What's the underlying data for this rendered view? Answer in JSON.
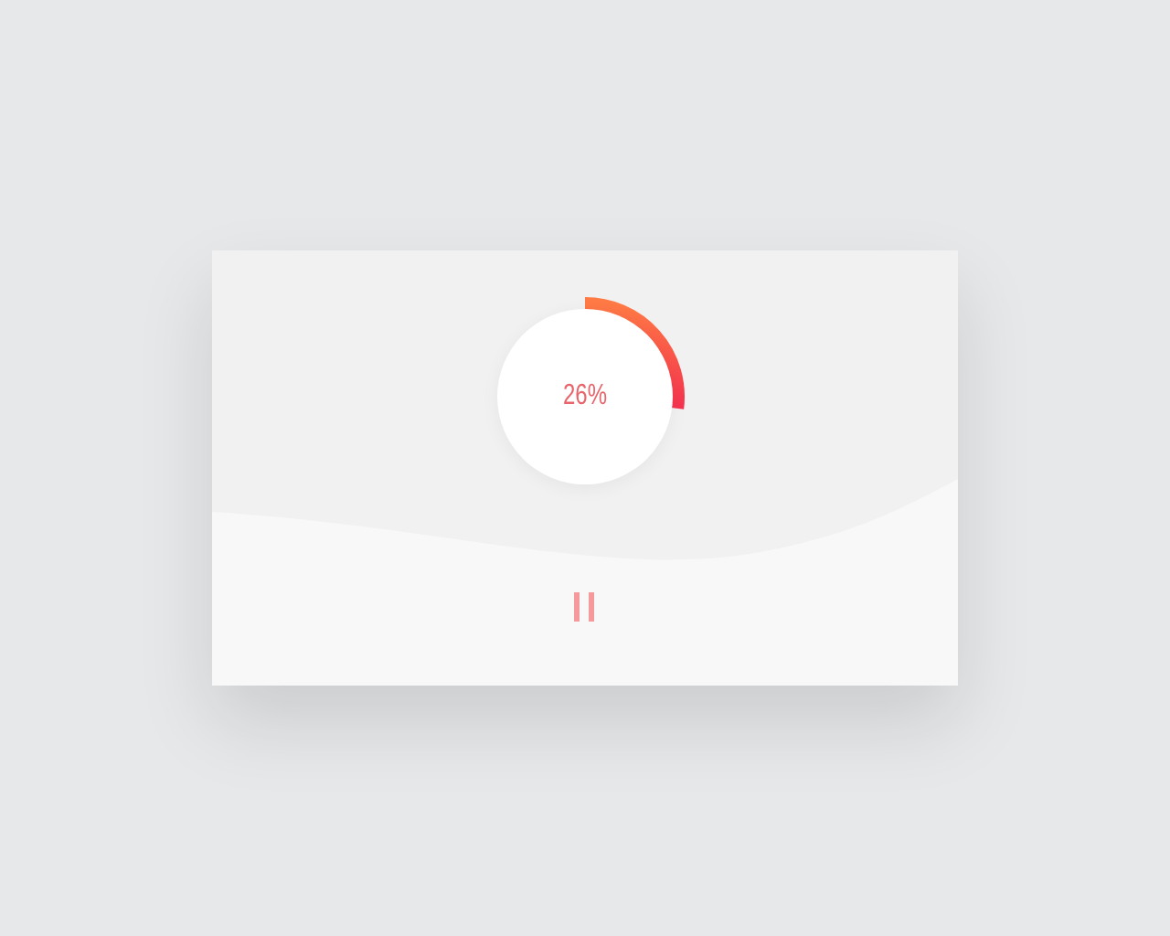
{
  "progress": {
    "label": "26%"
  },
  "controls": {
    "playing": true
  }
}
